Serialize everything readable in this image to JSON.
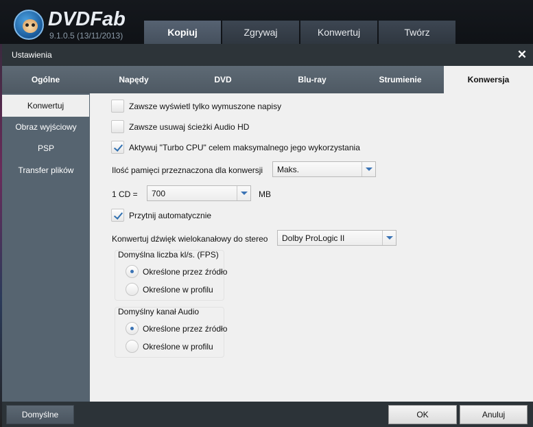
{
  "app": {
    "title": "DVDFab",
    "version": "9.1.0.5 (13/11/2013)",
    "main_tabs": [
      {
        "label": "Kopiuj",
        "active": true
      },
      {
        "label": "Zgrywaj",
        "active": false
      },
      {
        "label": "Konwertuj",
        "active": false
      },
      {
        "label": "Twórz",
        "active": false
      }
    ]
  },
  "dialog": {
    "title": "Ustawienia",
    "close_symbol": "✕",
    "tabs": [
      {
        "label": "Ogólne"
      },
      {
        "label": "Napędy"
      },
      {
        "label": "DVD"
      },
      {
        "label": "Blu-ray"
      },
      {
        "label": "Strumienie"
      },
      {
        "label": "Konwersja",
        "active": true
      }
    ],
    "sidebar": [
      {
        "label": "Konwertuj",
        "active": true
      },
      {
        "label": "Obraz wyjściowy"
      },
      {
        "label": "PSP"
      },
      {
        "label": "Transfer plików"
      }
    ]
  },
  "options": {
    "forced_subs": {
      "label": "Zawsze wyświetl tylko wymuszone napisy",
      "checked": false
    },
    "remove_hd_audio": {
      "label": "Zawsze usuwaj ścieżki Audio HD",
      "checked": false
    },
    "turbo_cpu": {
      "label": "Aktywuj \"Turbo CPU\" celem maksymalnego jego wykorzystania",
      "checked": true
    },
    "memory": {
      "label": "Ilość pamięci przeznaczona dla konwersji",
      "value": "Maks."
    },
    "cd_size": {
      "label": "1 CD =",
      "value": "700",
      "unit": "MB"
    },
    "auto_trim": {
      "label": "Przytnij automatycznie",
      "checked": true
    },
    "stereo_downmix": {
      "label": "Konwertuj dźwięk wielokanałowy do stereo",
      "value": "Dolby ProLogic II"
    },
    "fps_group": {
      "title": "Domyślna liczba kl/s. (FPS)",
      "options": [
        {
          "label": "Określone przez źródło",
          "selected": true
        },
        {
          "label": "Określone w profilu",
          "selected": false
        }
      ]
    },
    "audio_group": {
      "title": "Domyślny kanał Audio",
      "options": [
        {
          "label": "Określone przez źródło",
          "selected": true
        },
        {
          "label": "Określone w profilu",
          "selected": false
        }
      ]
    }
  },
  "footer": {
    "default_label": "Domyślne",
    "ok_label": "OK",
    "cancel_label": "Anuluj"
  }
}
